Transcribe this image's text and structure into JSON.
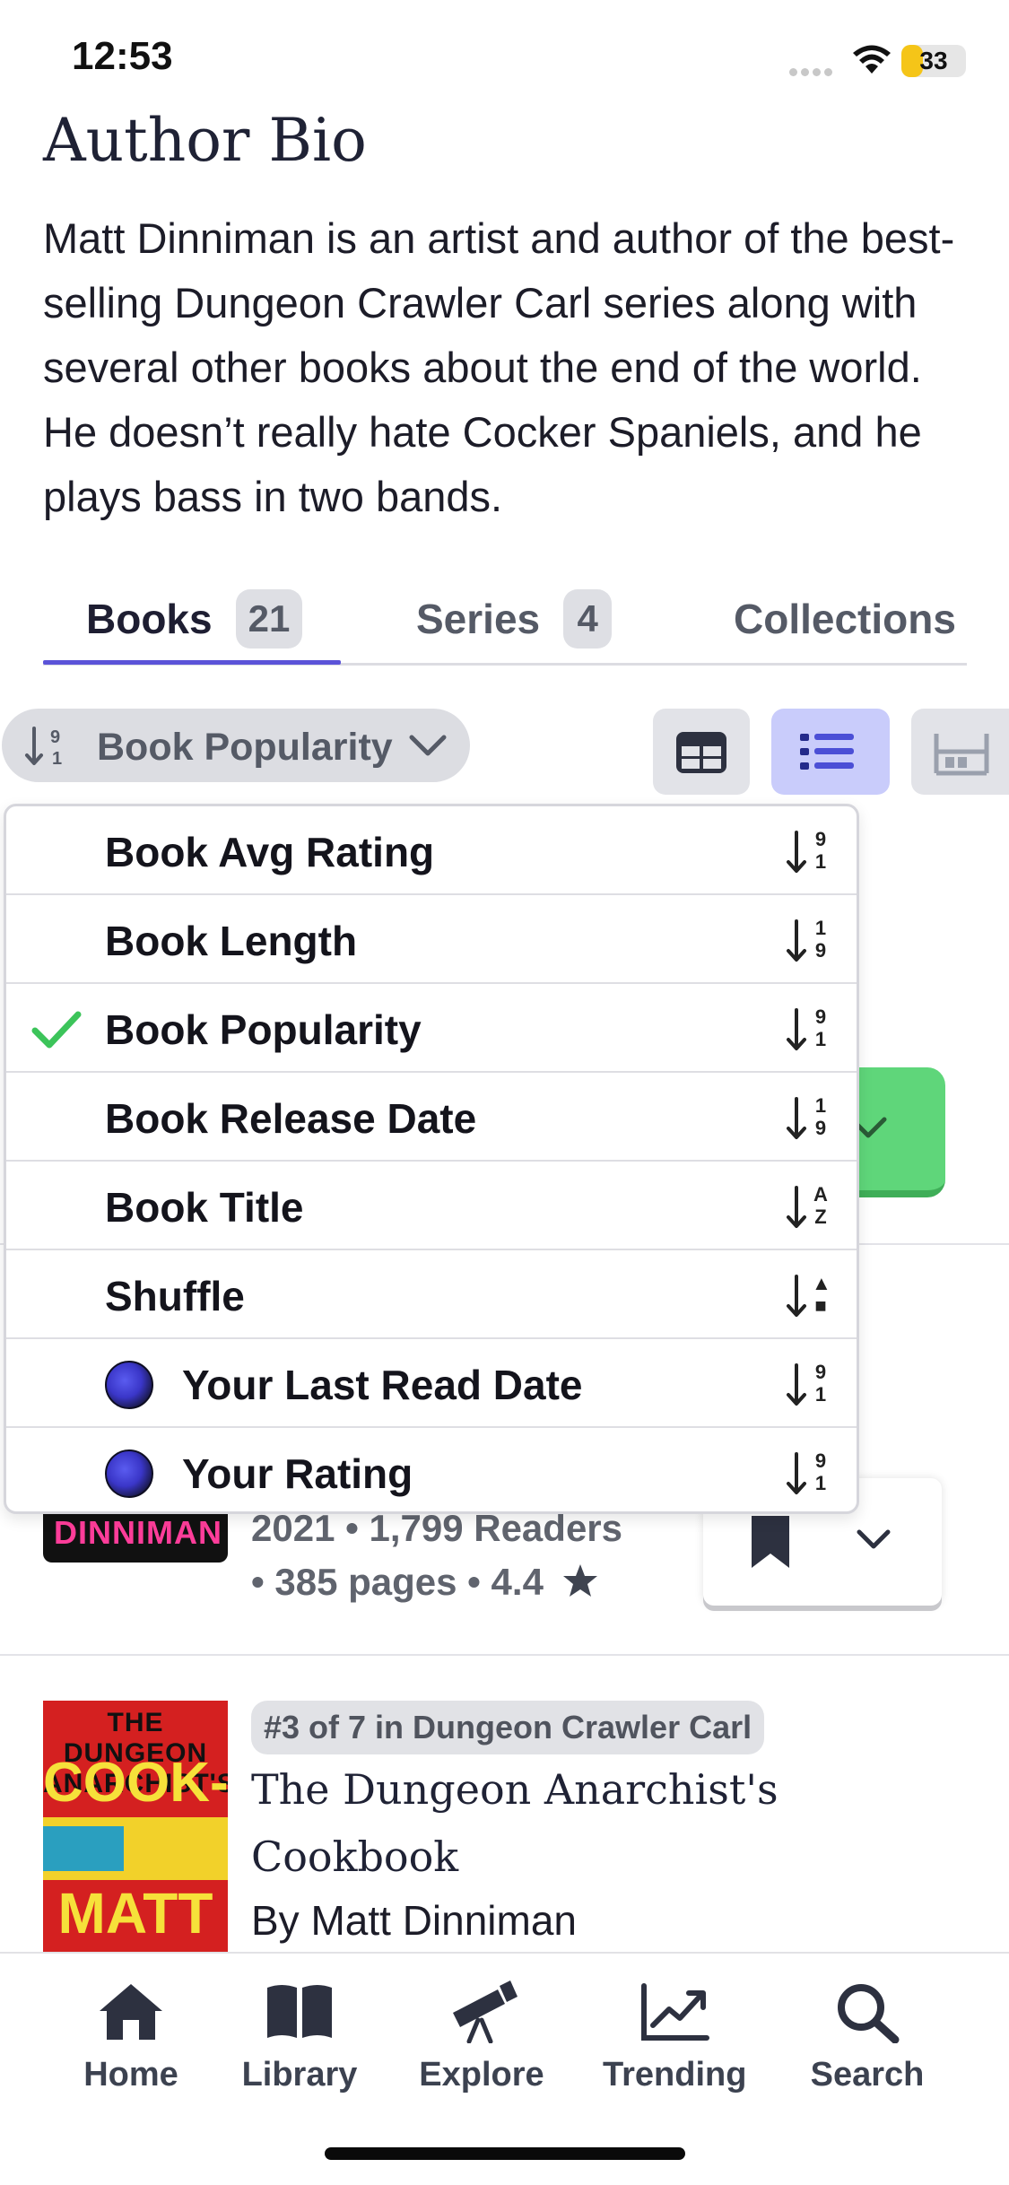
{
  "status_bar": {
    "time": "12:53",
    "battery": "33",
    "battery_level": 0.33
  },
  "bio": {
    "title": "Author Bio",
    "text": "Matt Dinniman is an artist and author of the best-selling Dungeon Crawler Carl series along with several other books about the end of the world. He doesn’t really hate Cocker Spaniels, and he plays bass in two bands."
  },
  "tabs": [
    {
      "label": "Books",
      "count": "21",
      "active": true
    },
    {
      "label": "Series",
      "count": "4",
      "active": false
    },
    {
      "label": "Collections",
      "count": "",
      "active": false
    }
  ],
  "sort": {
    "label": "Book Popularity"
  },
  "view_modes": [
    {
      "name": "grid-view",
      "active": false
    },
    {
      "name": "list-view",
      "active": true
    },
    {
      "name": "shelf-view",
      "active": false
    }
  ],
  "sort_menu": [
    {
      "label": "Book Avg Rating",
      "selected": false,
      "avatar": false,
      "sort_glyph": "9\n1"
    },
    {
      "label": "Book Length",
      "selected": false,
      "avatar": false,
      "sort_glyph": "1\n9"
    },
    {
      "label": "Book Popularity",
      "selected": true,
      "avatar": false,
      "sort_glyph": "9\n1"
    },
    {
      "label": "Book Release Date",
      "selected": false,
      "avatar": false,
      "sort_glyph": "1\n9"
    },
    {
      "label": "Book Title",
      "selected": false,
      "avatar": false,
      "sort_glyph": "A\nZ"
    },
    {
      "label": "Shuffle",
      "selected": false,
      "avatar": false,
      "sort_glyph": "▲\n■"
    },
    {
      "label": "Your Last Read Date",
      "selected": false,
      "avatar": true,
      "sort_glyph": "9\n1"
    },
    {
      "label": "Your Rating",
      "selected": false,
      "avatar": true,
      "sort_glyph": "9\n1"
    }
  ],
  "book_1": {
    "cover_text": "DINNIMAN",
    "meta_line1": "2021 • 1,799 Readers",
    "meta_line2": "• 385 pages • 4.4"
  },
  "book_2": {
    "series_badge": "#3 of 7 in Dungeon Crawler Carl",
    "title": "The Dungeon Anarchist's Cookbook",
    "author": "By Matt Dinniman",
    "cover_line1": "THE DUNGEON ANARCHIST'S",
    "cover_line2": "COOK-BOOK",
    "cover_line3": "MATT DINNIMAN"
  },
  "bottom_nav": [
    {
      "label": "Home",
      "icon": "home-icon"
    },
    {
      "label": "Library",
      "icon": "book-icon"
    },
    {
      "label": "Explore",
      "icon": "telescope-icon"
    },
    {
      "label": "Trending",
      "icon": "trending-chart-icon"
    },
    {
      "label": "Search",
      "icon": "search-icon"
    }
  ],
  "colors": {
    "accent": "#5b53d8",
    "active_view_bg": "#c9ccfb",
    "check_green": "#3cc45a",
    "want_to_read_green": "#5fd67a"
  }
}
